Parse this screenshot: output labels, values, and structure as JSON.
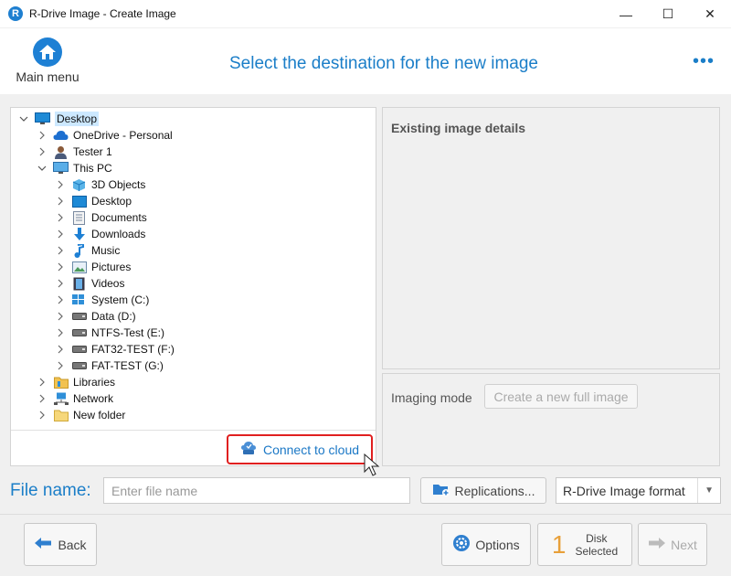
{
  "window": {
    "title": "R-Drive Image - Create Image",
    "logo_letter": "R",
    "minimize": "—",
    "maximize": "☐",
    "close": "✕"
  },
  "header": {
    "main_menu_label": "Main menu",
    "page_title": "Select the destination for the new image",
    "more_label": "•••"
  },
  "tree": {
    "items": [
      {
        "label": "Desktop",
        "icon": "desktop-icon",
        "expanded": true,
        "selected": true
      },
      {
        "label": "OneDrive - Personal",
        "icon": "onedrive-cloud-icon"
      },
      {
        "label": "Tester 1",
        "icon": "user-icon"
      },
      {
        "label": "This PC",
        "icon": "computer-icon",
        "expanded": true
      },
      {
        "label": "3D Objects",
        "icon": "cube-icon"
      },
      {
        "label": "Desktop",
        "icon": "desktop-folder-icon"
      },
      {
        "label": "Documents",
        "icon": "document-icon"
      },
      {
        "label": "Downloads",
        "icon": "download-arrow-icon"
      },
      {
        "label": "Music",
        "icon": "music-note-icon"
      },
      {
        "label": "Pictures",
        "icon": "picture-icon"
      },
      {
        "label": "Videos",
        "icon": "video-film-icon"
      },
      {
        "label": "System (C:)",
        "icon": "system-drive-icon"
      },
      {
        "label": "Data (D:)",
        "icon": "drive-icon"
      },
      {
        "label": "NTFS-Test (E:)",
        "icon": "drive-icon"
      },
      {
        "label": "FAT32-TEST (F:)",
        "icon": "drive-icon"
      },
      {
        "label": "FAT-TEST (G:)",
        "icon": "drive-icon"
      },
      {
        "label": "Libraries",
        "icon": "library-folder-icon"
      },
      {
        "label": "Network",
        "icon": "network-icon"
      },
      {
        "label": "New folder",
        "icon": "folder-icon"
      }
    ],
    "connect_cloud_label": "Connect to cloud"
  },
  "details": {
    "title": "Existing image details"
  },
  "imaging": {
    "label": "Imaging mode",
    "button_label": "Create a new full image"
  },
  "file": {
    "label": "File name:",
    "placeholder": "Enter file name",
    "value": "",
    "replications_label": "Replications...",
    "format_value": "R-Drive Image format"
  },
  "footer": {
    "back_label": "Back",
    "options_label": "Options",
    "disk_count": "1",
    "disk_line1": "Disk",
    "disk_line2": "Selected",
    "next_label": "Next"
  },
  "colors": {
    "accent": "#1b7ec8",
    "highlight": "#e02020",
    "selection": "#cce8ff"
  }
}
